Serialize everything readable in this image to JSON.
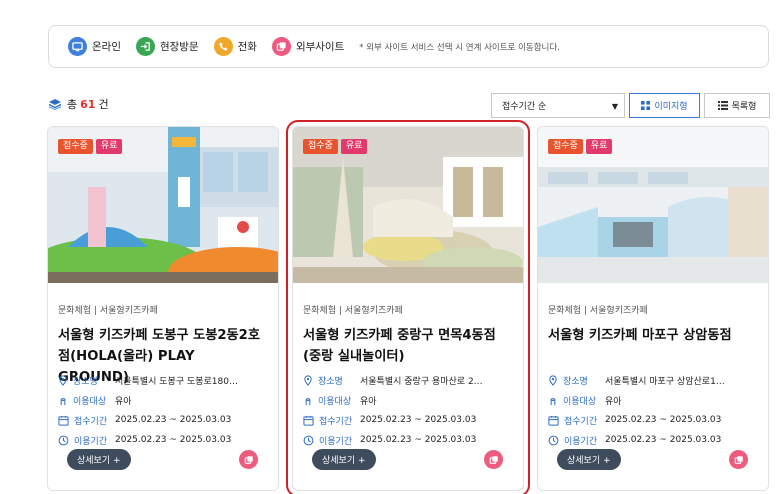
{
  "legend": {
    "items": [
      {
        "label": "온라인",
        "icon": "monitor-icon",
        "color": "#3d7fd9"
      },
      {
        "label": "현장방문",
        "icon": "enter-icon",
        "color": "#3aa655"
      },
      {
        "label": "전화",
        "icon": "phone-icon",
        "color": "#f0a82a"
      },
      {
        "label": "외부사이트",
        "icon": "external-link-icon",
        "color": "#ef5b7e"
      }
    ],
    "note": "* 외부 사이트 서비스 선택 시 연계 사이트로 이동합니다."
  },
  "toolbar": {
    "count_prefix": "총",
    "count": "61",
    "count_suffix": "건",
    "sort_selected": "접수기간 순",
    "view_image_label": "이미지형",
    "view_list_label": "목록형"
  },
  "labels": {
    "place": "장소명",
    "target": "이용대상",
    "reception": "접수기간",
    "use": "이용기간",
    "detail": "상세보기 +"
  },
  "cards": [
    {
      "badge_status": "접수중",
      "badge_fee": "유료",
      "category": "문화체험 | 서울형키즈카페",
      "title": "서울형 키즈카페 도봉구 도봉2동2호점(HOLA(올라) PLAY GROUND)",
      "place": "서울특별시 도봉구 도봉로180…",
      "target": "유아",
      "reception": "2025.02.23 ~ 2025.03.03",
      "use": "2025.02.23 ~ 2025.03.03"
    },
    {
      "badge_status": "접수중",
      "badge_fee": "유료",
      "category": "문화체험 | 서울형키즈카페",
      "title": "서울형 키즈카페 중랑구 면목4동점(중랑 실내놀이터)",
      "place": "서울특별시 중랑구 용마산로 2…",
      "target": "유아",
      "reception": "2025.02.23 ~ 2025.03.03",
      "use": "2025.02.23 ~ 2025.03.03"
    },
    {
      "badge_status": "접수중",
      "badge_fee": "유료",
      "category": "문화체험 | 서울형키즈카페",
      "title": "서울형 키즈카페 마포구 상암동점",
      "place": "서울특별시 마포구 상암산로1…",
      "target": "유아",
      "reception": "2025.02.23 ~ 2025.03.03",
      "use": "2025.02.23 ~ 2025.03.03"
    }
  ]
}
